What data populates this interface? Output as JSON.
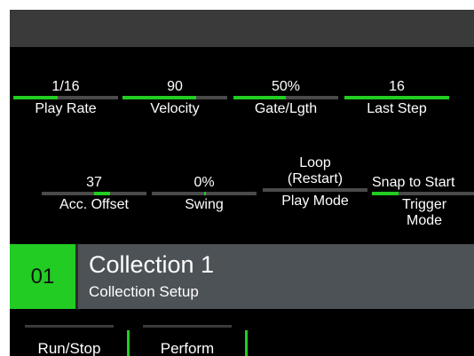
{
  "row1": [
    {
      "value": "1/16",
      "label": "Play Rate",
      "level": 0.42
    },
    {
      "value": "90",
      "label": "Velocity",
      "level": 0.7
    },
    {
      "value": "50%",
      "label": "Gate/Lgth",
      "level": 0.5
    },
    {
      "value": "16",
      "label": "Last Step",
      "level": 1.0
    }
  ],
  "row2": [
    {
      "value": "37",
      "label": "Acc. Offset",
      "fill_start": 0.5,
      "level": 0.65
    },
    {
      "value": "0%",
      "label": "Swing",
      "fill_start": 0.5,
      "level": 0.52
    },
    {
      "value": "Loop\n(Restart)",
      "label": "Play Mode",
      "level": 0
    },
    {
      "value": "Snap to Start",
      "label": "Trigger\nMode",
      "level": 0.25
    }
  ],
  "collection": {
    "number": "01",
    "name": "Collection 1",
    "subtitle": "Collection Setup"
  },
  "softkeys": [
    {
      "label": "Run/Stop"
    },
    {
      "label": "Perform"
    }
  ],
  "colors": {
    "accent": "#22cc22",
    "bar_bg": "#4a4a4a",
    "info_bg": "#4d5257"
  }
}
